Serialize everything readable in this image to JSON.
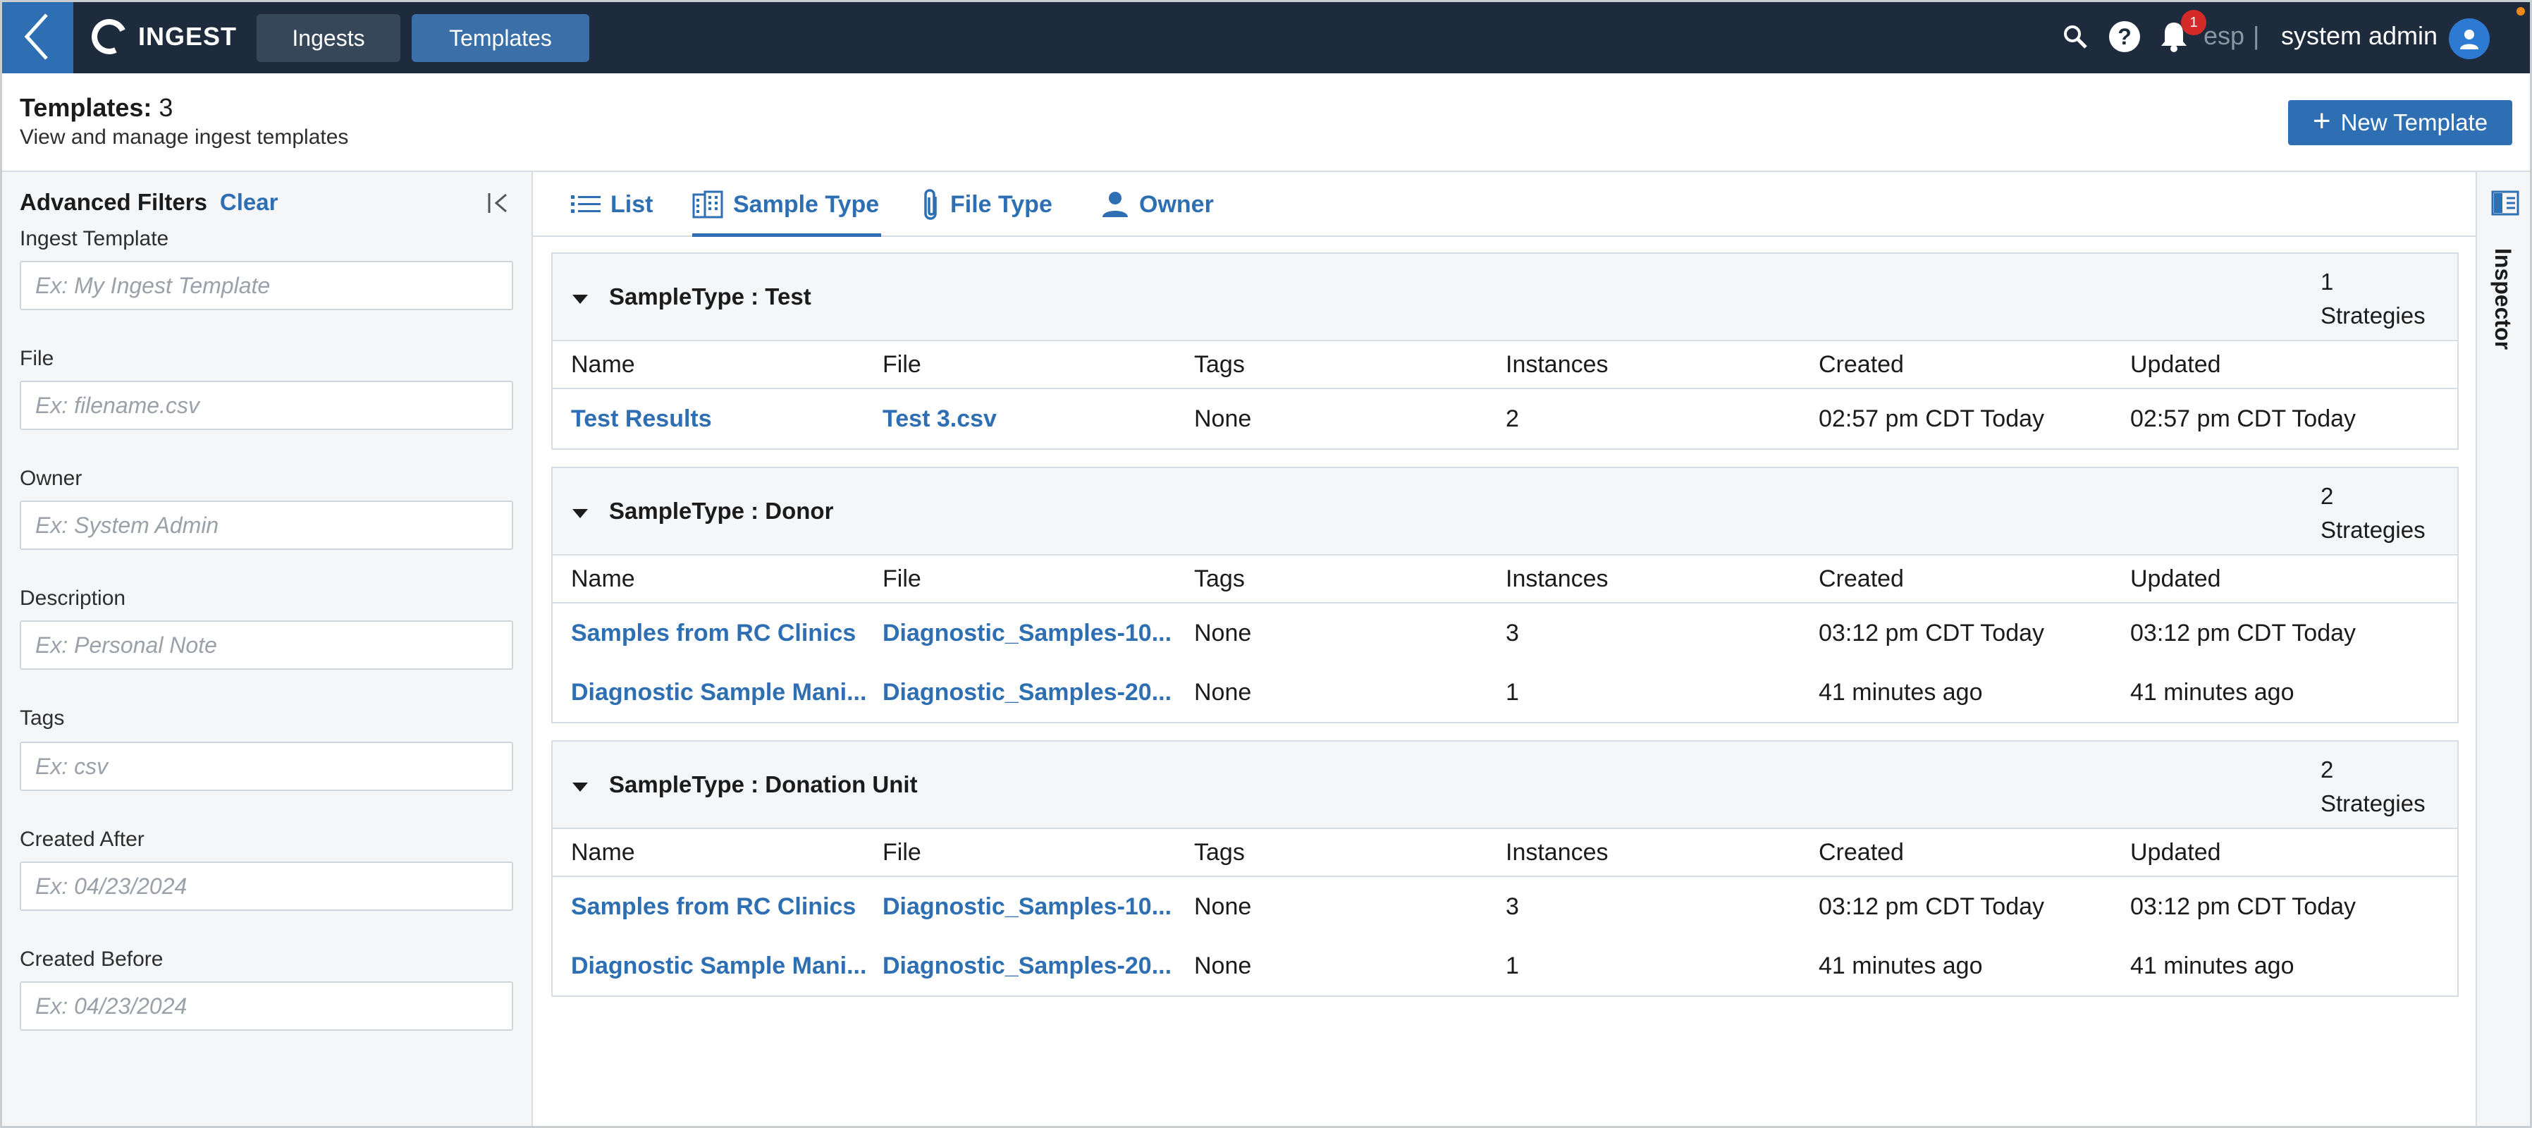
{
  "app": {
    "brand": "INGEST",
    "nav": {
      "ingests": "Ingests",
      "templates": "Templates"
    }
  },
  "topbar": {
    "lang": "esp",
    "separator": "|",
    "user": "system admin",
    "notifications": "1"
  },
  "header": {
    "title_prefix": "Templates:",
    "title_count": "3",
    "subtitle": "View and manage ingest templates",
    "new_button": "New Template"
  },
  "filters": {
    "title": "Advanced Filters",
    "clear": "Clear",
    "fields": [
      {
        "label": "Ingest Template",
        "placeholder": "Ex: My Ingest Template"
      },
      {
        "label": "File",
        "placeholder": "Ex: filename.csv"
      },
      {
        "label": "Owner",
        "placeholder": "Ex: System Admin"
      },
      {
        "label": "Description",
        "placeholder": "Ex: Personal Note"
      },
      {
        "label": "Tags",
        "placeholder": "Ex: csv"
      },
      {
        "label": "Created After",
        "placeholder": "Ex: 04/23/2024"
      },
      {
        "label": "Created Before",
        "placeholder": "Ex: 04/23/2024"
      }
    ]
  },
  "tabs": {
    "list": "List",
    "sample_type": "Sample Type",
    "file_type": "File Type",
    "owner": "Owner"
  },
  "columns": {
    "name": "Name",
    "file": "File",
    "tags": "Tags",
    "instances": "Instances",
    "created": "Created",
    "updated": "Updated"
  },
  "groups": [
    {
      "title": "SampleType : Test",
      "count": "1",
      "count_label": "Strategies",
      "rows": [
        {
          "name": "Test Results",
          "file": "Test 3.csv",
          "tags": "None",
          "instances": "2",
          "created": "02:57 pm CDT Today",
          "updated": "02:57 pm CDT Today"
        }
      ]
    },
    {
      "title": "SampleType : Donor",
      "count": "2",
      "count_label": "Strategies",
      "rows": [
        {
          "name": "Samples from RC Clinics",
          "file": "Diagnostic_Samples-10...",
          "tags": "None",
          "instances": "3",
          "created": "03:12 pm CDT Today",
          "updated": "03:12 pm CDT Today"
        },
        {
          "name": "Diagnostic Sample Mani...",
          "file": "Diagnostic_Samples-20...",
          "tags": "None",
          "instances": "1",
          "created": "41 minutes ago",
          "updated": "41 minutes ago"
        }
      ]
    },
    {
      "title": "SampleType : Donation Unit",
      "count": "2",
      "count_label": "Strategies",
      "rows": [
        {
          "name": "Samples from RC Clinics",
          "file": "Diagnostic_Samples-10...",
          "tags": "None",
          "instances": "3",
          "created": "03:12 pm CDT Today",
          "updated": "03:12 pm CDT Today"
        },
        {
          "name": "Diagnostic Sample Mani...",
          "file": "Diagnostic_Samples-20...",
          "tags": "None",
          "instances": "1",
          "created": "41 minutes ago",
          "updated": "41 minutes ago"
        }
      ]
    }
  ],
  "inspector": {
    "label": "Inspector"
  },
  "icons": [
    "back-chevron-icon",
    "brand-logo-icon",
    "search-icon",
    "help-icon",
    "bell-icon",
    "user-avatar-icon",
    "plus-icon",
    "collapse-sidebar-icon",
    "list-icon",
    "sample-type-icon",
    "paperclip-icon",
    "person-icon",
    "caret-down-icon",
    "inspector-panel-icon"
  ],
  "colors": {
    "topbar": "#1d2b3c",
    "accent": "#2d6fb2",
    "badge": "#d42a2a"
  }
}
